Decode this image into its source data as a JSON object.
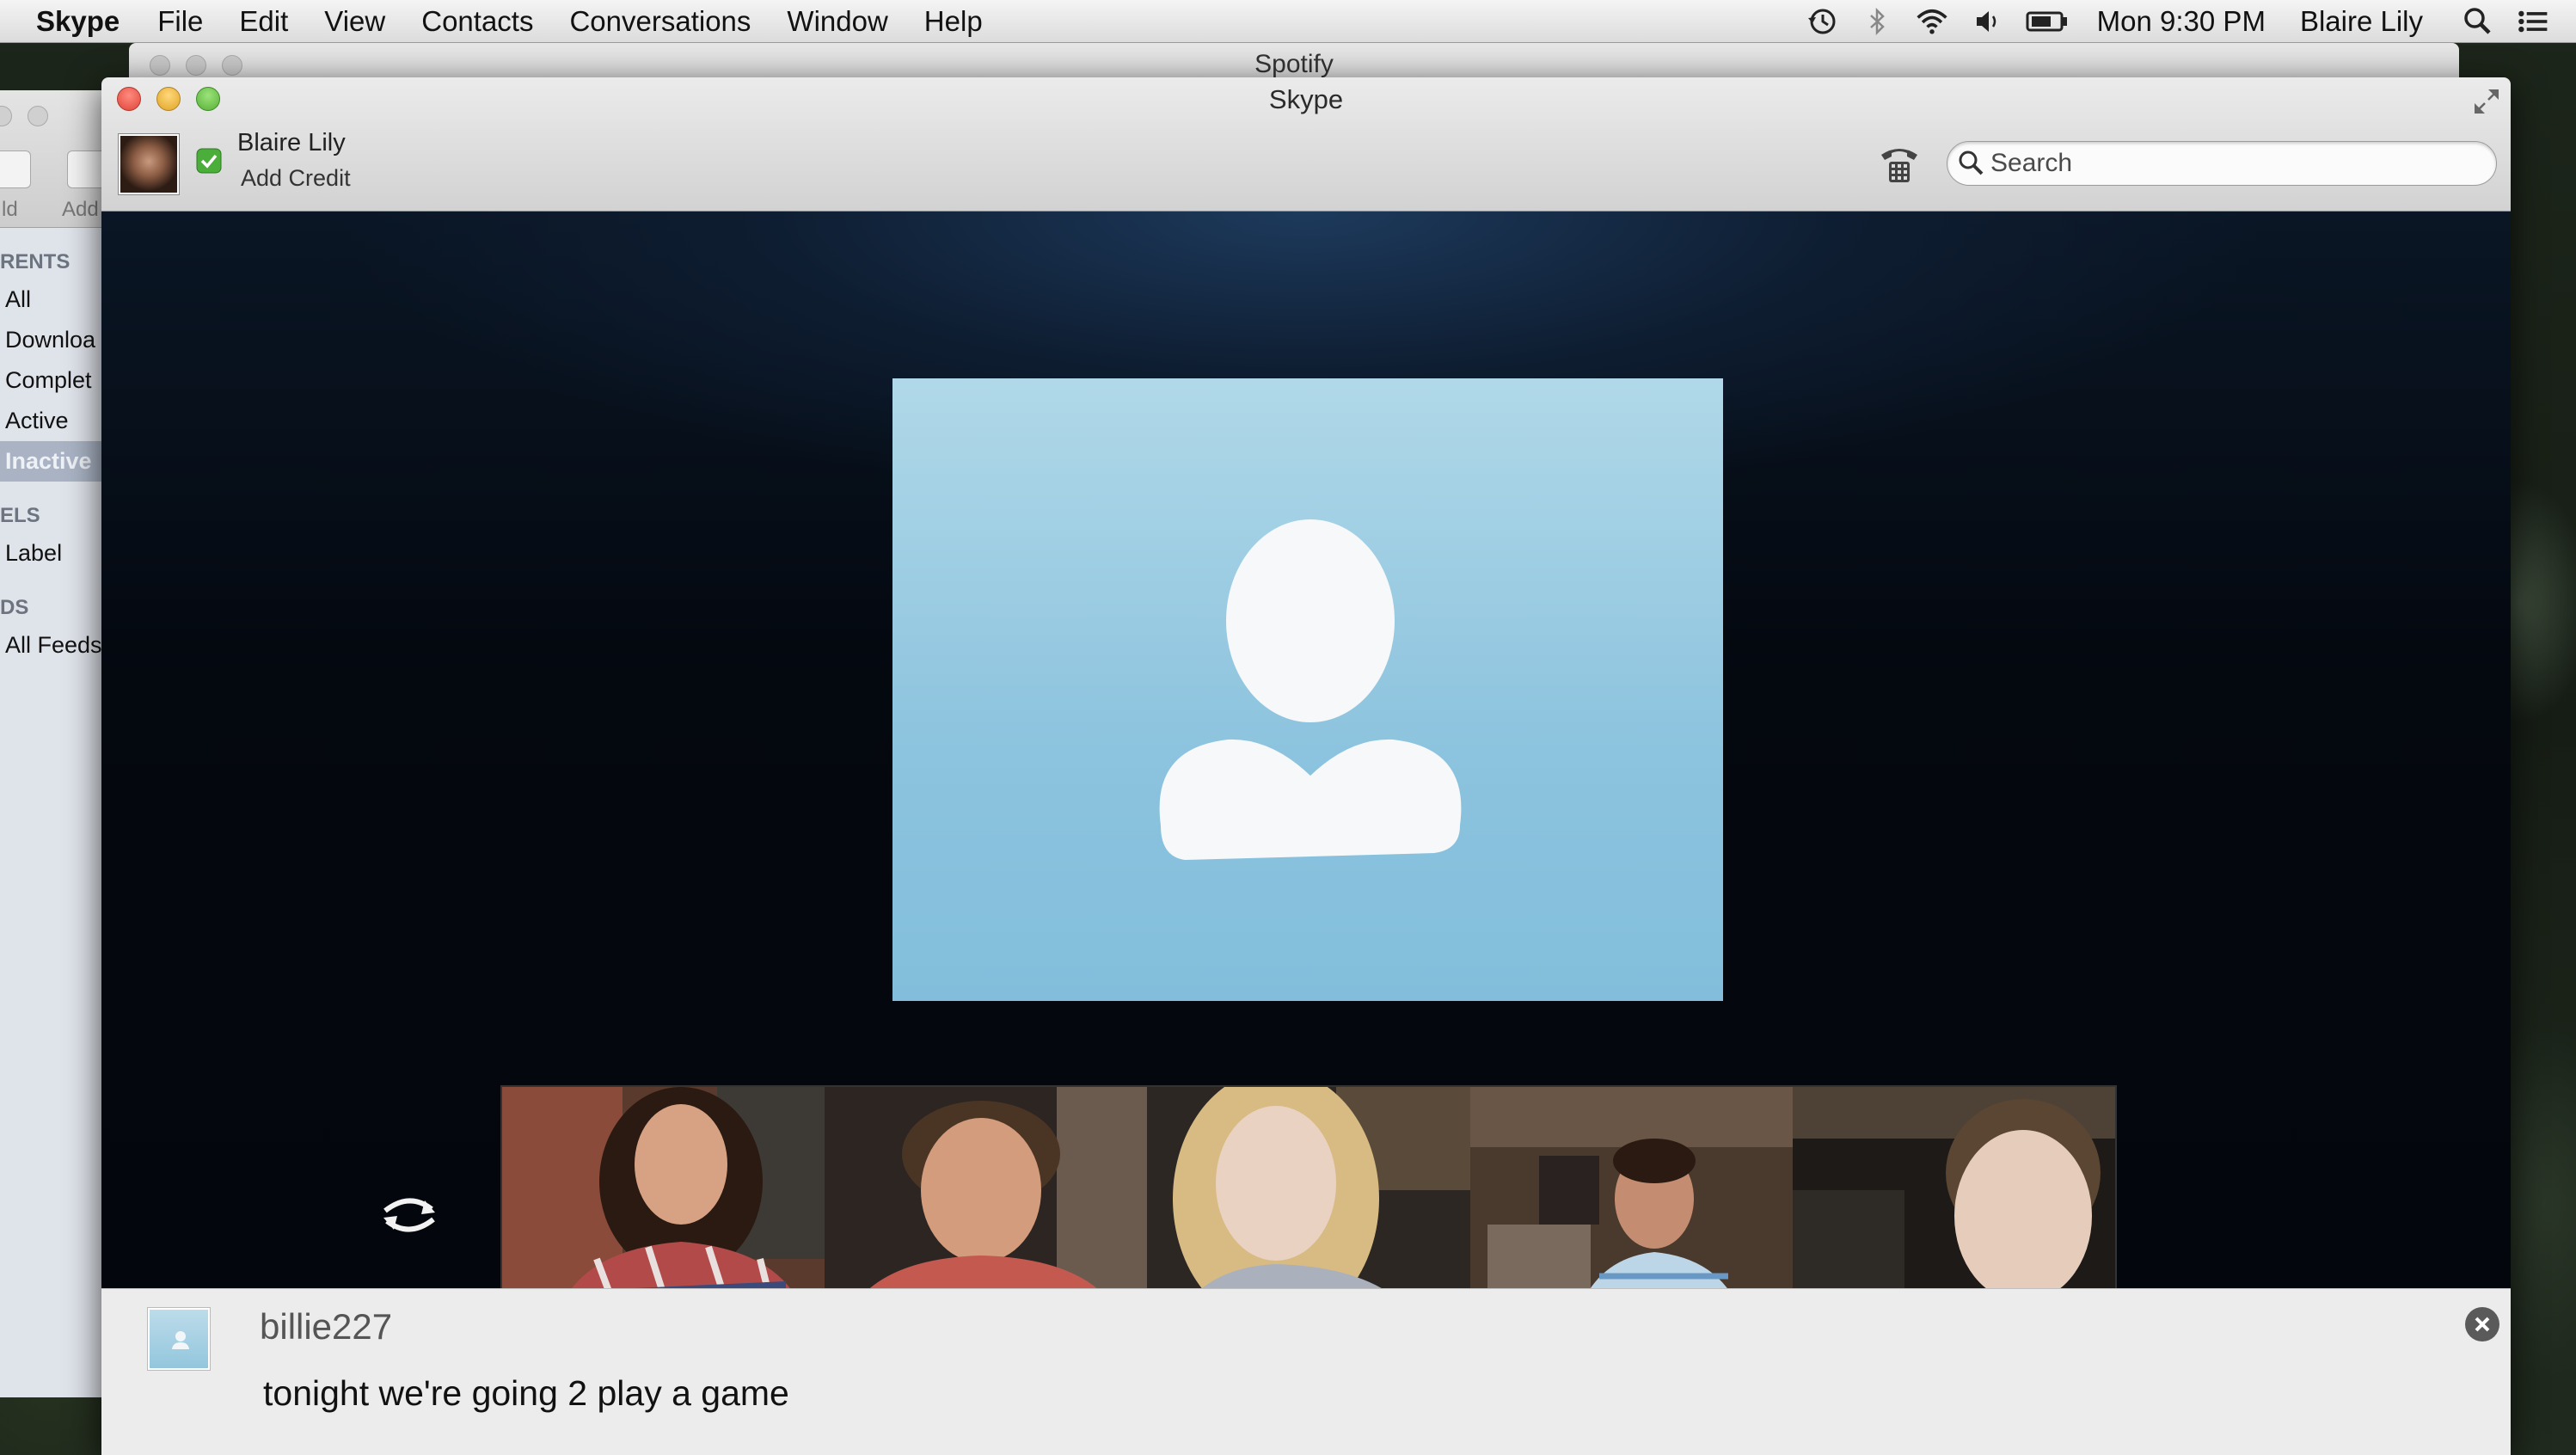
{
  "menubar": {
    "app_name": "Skype",
    "menus": [
      "File",
      "Edit",
      "View",
      "Contacts",
      "Conversations",
      "Window",
      "Help"
    ],
    "clock": "Mon 9:30 PM",
    "user": "Blaire Lily",
    "status_icons": [
      "time-machine-icon",
      "bluetooth-icon",
      "wifi-icon",
      "volume-icon",
      "battery-icon",
      "spotlight-search-icon",
      "notification-center-icon"
    ]
  },
  "background_windows": {
    "spotify_title": "Spotify",
    "torrent": {
      "toolbar_labels": [
        "ld",
        "Add"
      ],
      "sections": [
        {
          "title": "RENTS",
          "items": [
            "All",
            "Downloa",
            "Complet",
            "Active",
            "Inactive"
          ],
          "selected": "Inactive"
        },
        {
          "title": "ELS",
          "items": [
            "Label"
          ]
        },
        {
          "title": "DS",
          "items": [
            "All Feeds"
          ]
        }
      ]
    }
  },
  "skype": {
    "window_title": "Skype",
    "profile": {
      "name": "Blaire Lily",
      "add_credit": "Add Credit",
      "status_color": "#4cae3a"
    },
    "search": {
      "placeholder": "Search",
      "value": ""
    },
    "participants_count": 5,
    "notification": {
      "sender": "billie227",
      "message": "tonight we're going 2 play a game"
    }
  },
  "colors": {
    "video_placeholder": "#9fcde3",
    "call_background": "#04080f",
    "accent_blue": "#1d3a5c"
  }
}
